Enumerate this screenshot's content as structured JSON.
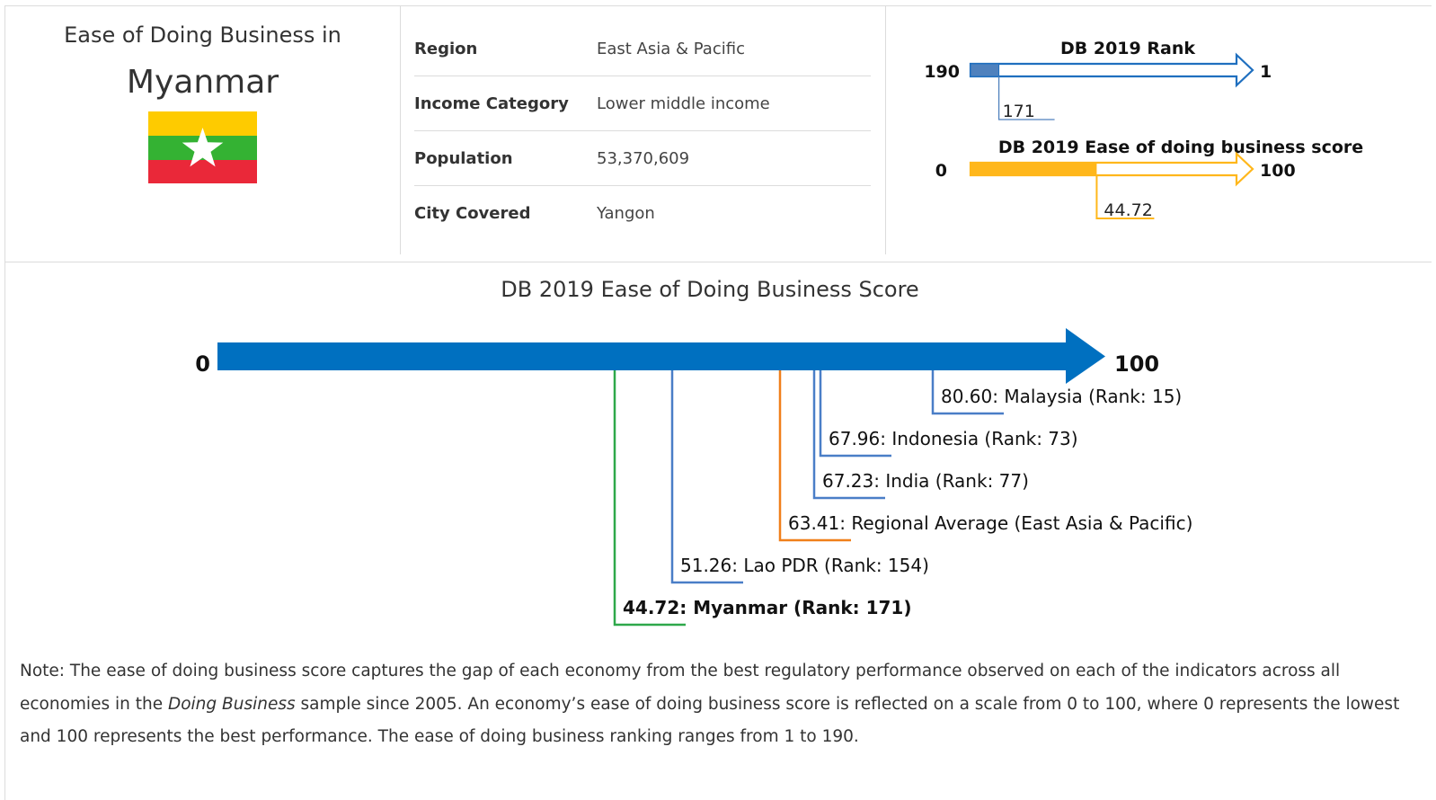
{
  "country": {
    "heading": "Ease of Doing Business in",
    "name": "Myanmar",
    "flag_colors": {
      "top": "#FECB00",
      "middle": "#34B233",
      "bottom": "#EA2839",
      "star": "#FFFFFF"
    }
  },
  "info": {
    "rows": [
      {
        "label": "Region",
        "value": "East Asia & Pacific"
      },
      {
        "label": "Income Category",
        "value": "Lower middle income"
      },
      {
        "label": "Population",
        "value": "53,370,609"
      },
      {
        "label": "City Covered",
        "value": "Yangon"
      }
    ]
  },
  "colors": {
    "rank_blue": "#1F6FBF",
    "rank_fill": "#4F81BD",
    "score_gold": "#FFB71B",
    "main_blue": "#0070C0",
    "highlight_green": "#2EA84A",
    "regional_orange": "#F07F1A",
    "peer_blue": "#4A7EC7"
  },
  "chart_data": [
    {
      "type": "bar",
      "title": "DB 2019 Rank",
      "xlim": [
        190,
        1
      ],
      "min_label": "190",
      "max_label": "1",
      "value": 171,
      "value_label": "171"
    },
    {
      "type": "bar",
      "title": "DB 2019 Ease of doing business score",
      "xlim": [
        0,
        100
      ],
      "min_label": "0",
      "max_label": "100",
      "value": 44.72,
      "value_label": "44.72"
    },
    {
      "type": "scatter",
      "title": "DB 2019 Ease of Doing Business Score",
      "xlim": [
        0,
        100
      ],
      "min_label": "0",
      "max_label": "100",
      "points": [
        {
          "label": "80.60: Malaysia (Rank: 15)",
          "value": 80.6,
          "color": "#4A7EC7",
          "highlight": false
        },
        {
          "label": "67.96: Indonesia (Rank: 73)",
          "value": 67.96,
          "color": "#4A7EC7",
          "highlight": false
        },
        {
          "label": "67.23: India (Rank: 77)",
          "value": 67.23,
          "color": "#4A7EC7",
          "highlight": false
        },
        {
          "label": "63.41: Regional Average (East Asia & Pacific)",
          "value": 63.41,
          "color": "#F07F1A",
          "highlight": false
        },
        {
          "label": "51.26: Lao PDR (Rank: 154)",
          "value": 51.26,
          "color": "#4A7EC7",
          "highlight": false
        },
        {
          "label": "44.72: Myanmar (Rank: 171)",
          "value": 44.72,
          "color": "#2EA84A",
          "highlight": true
        }
      ]
    }
  ],
  "note": {
    "prefix": "Note: The ease of doing business score captures the gap of each economy from the best regulatory performance observed on each of the indicators across all economies in the ",
    "italic": "Doing Business",
    "suffix": " sample since 2005. An economy’s ease of doing business score is reflected on a scale from 0 to 100, where 0 represents the lowest and 100 represents the best performance. The ease of doing business ranking ranges from 1 to 190."
  }
}
